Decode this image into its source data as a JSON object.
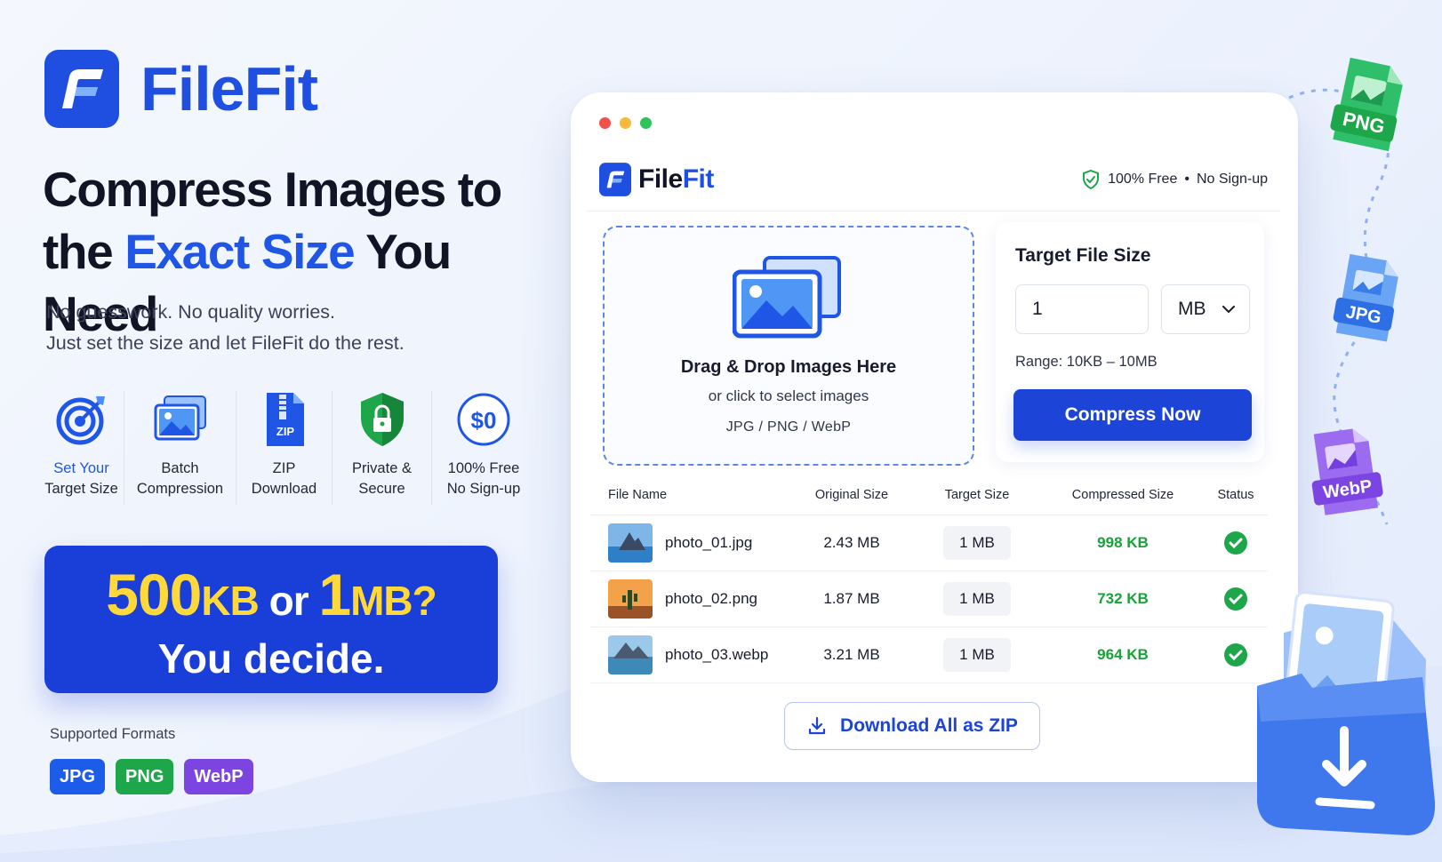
{
  "brand": {
    "name": "FileFit"
  },
  "hero": {
    "headline_part1": "Compress Images to",
    "headline_part2": "the ",
    "headline_accent": "Exact Size",
    "headline_part3": " You Need",
    "sub_line1": "No guesswork. No quality worries.",
    "sub_line2": "Just set the size and let FileFit do the rest."
  },
  "features": [
    {
      "icon": "target-icon",
      "label_a": "Set Your",
      "label_b": "Target Size"
    },
    {
      "icon": "images-icon",
      "label_a": "Batch",
      "label_b": "Compression"
    },
    {
      "icon": "zip-file-icon",
      "label_a": "ZIP",
      "label_b": "Download",
      "icon_text": "ZIP"
    },
    {
      "icon": "shield-lock-icon",
      "label_a": "Private &",
      "label_b": "Secure"
    },
    {
      "icon": "dollar-zero-icon",
      "label_a": "100% Free",
      "label_b": "No Sign-up",
      "icon_text": "$0"
    }
  ],
  "promo": {
    "num1": "500",
    "unit1": "KB",
    "or": " or ",
    "num2": "1",
    "unit2": "MB?",
    "line2": "You decide."
  },
  "formats": {
    "label": "Supported Formats",
    "items": [
      {
        "label": "JPG",
        "color": "#1d5ce8"
      },
      {
        "label": "PNG",
        "color": "#1ea64a"
      },
      {
        "label": "WebP",
        "color": "#7c44e0"
      }
    ]
  },
  "window": {
    "dot_colors": [
      "#f0524a",
      "#f6b93b",
      "#2fc25a"
    ],
    "app_name_a": "File",
    "app_name_b": "Fit",
    "free_a": "100% Free",
    "free_sep": "•",
    "free_b": "No Sign-up",
    "drop": {
      "title": "Drag & Drop Images Here",
      "subtitle": "or click to select images",
      "types": "JPG / PNG / WebP"
    },
    "target": {
      "title": "Target File Size",
      "value": "1",
      "unit": "MB",
      "range": "Range: 10KB – 10MB",
      "button": "Compress Now"
    },
    "table": {
      "headers": {
        "name": "File Name",
        "original": "Original Size",
        "target": "Target Size",
        "compressed": "Compressed Size",
        "status": "Status"
      },
      "rows": [
        {
          "name": "photo_01.jpg",
          "original": "2.43 MB",
          "target": "1 MB",
          "compressed": "998 KB",
          "status": "done"
        },
        {
          "name": "photo_02.png",
          "original": "1.87 MB",
          "target": "1 MB",
          "compressed": "732 KB",
          "status": "done"
        },
        {
          "name": "photo_03.webp",
          "original": "3.21 MB",
          "target": "1 MB",
          "compressed": "964 KB",
          "status": "done"
        }
      ]
    },
    "download": "Download All as ZIP"
  },
  "decor": {
    "png_badge": "PNG",
    "jpg_badge": "JPG",
    "webp_badge": "WebP"
  },
  "colors": {
    "brand_blue": "#1f4fe0",
    "button_blue": "#1c44d6",
    "success_green": "#19a23a",
    "promo_yellow": "#ffd93a"
  }
}
